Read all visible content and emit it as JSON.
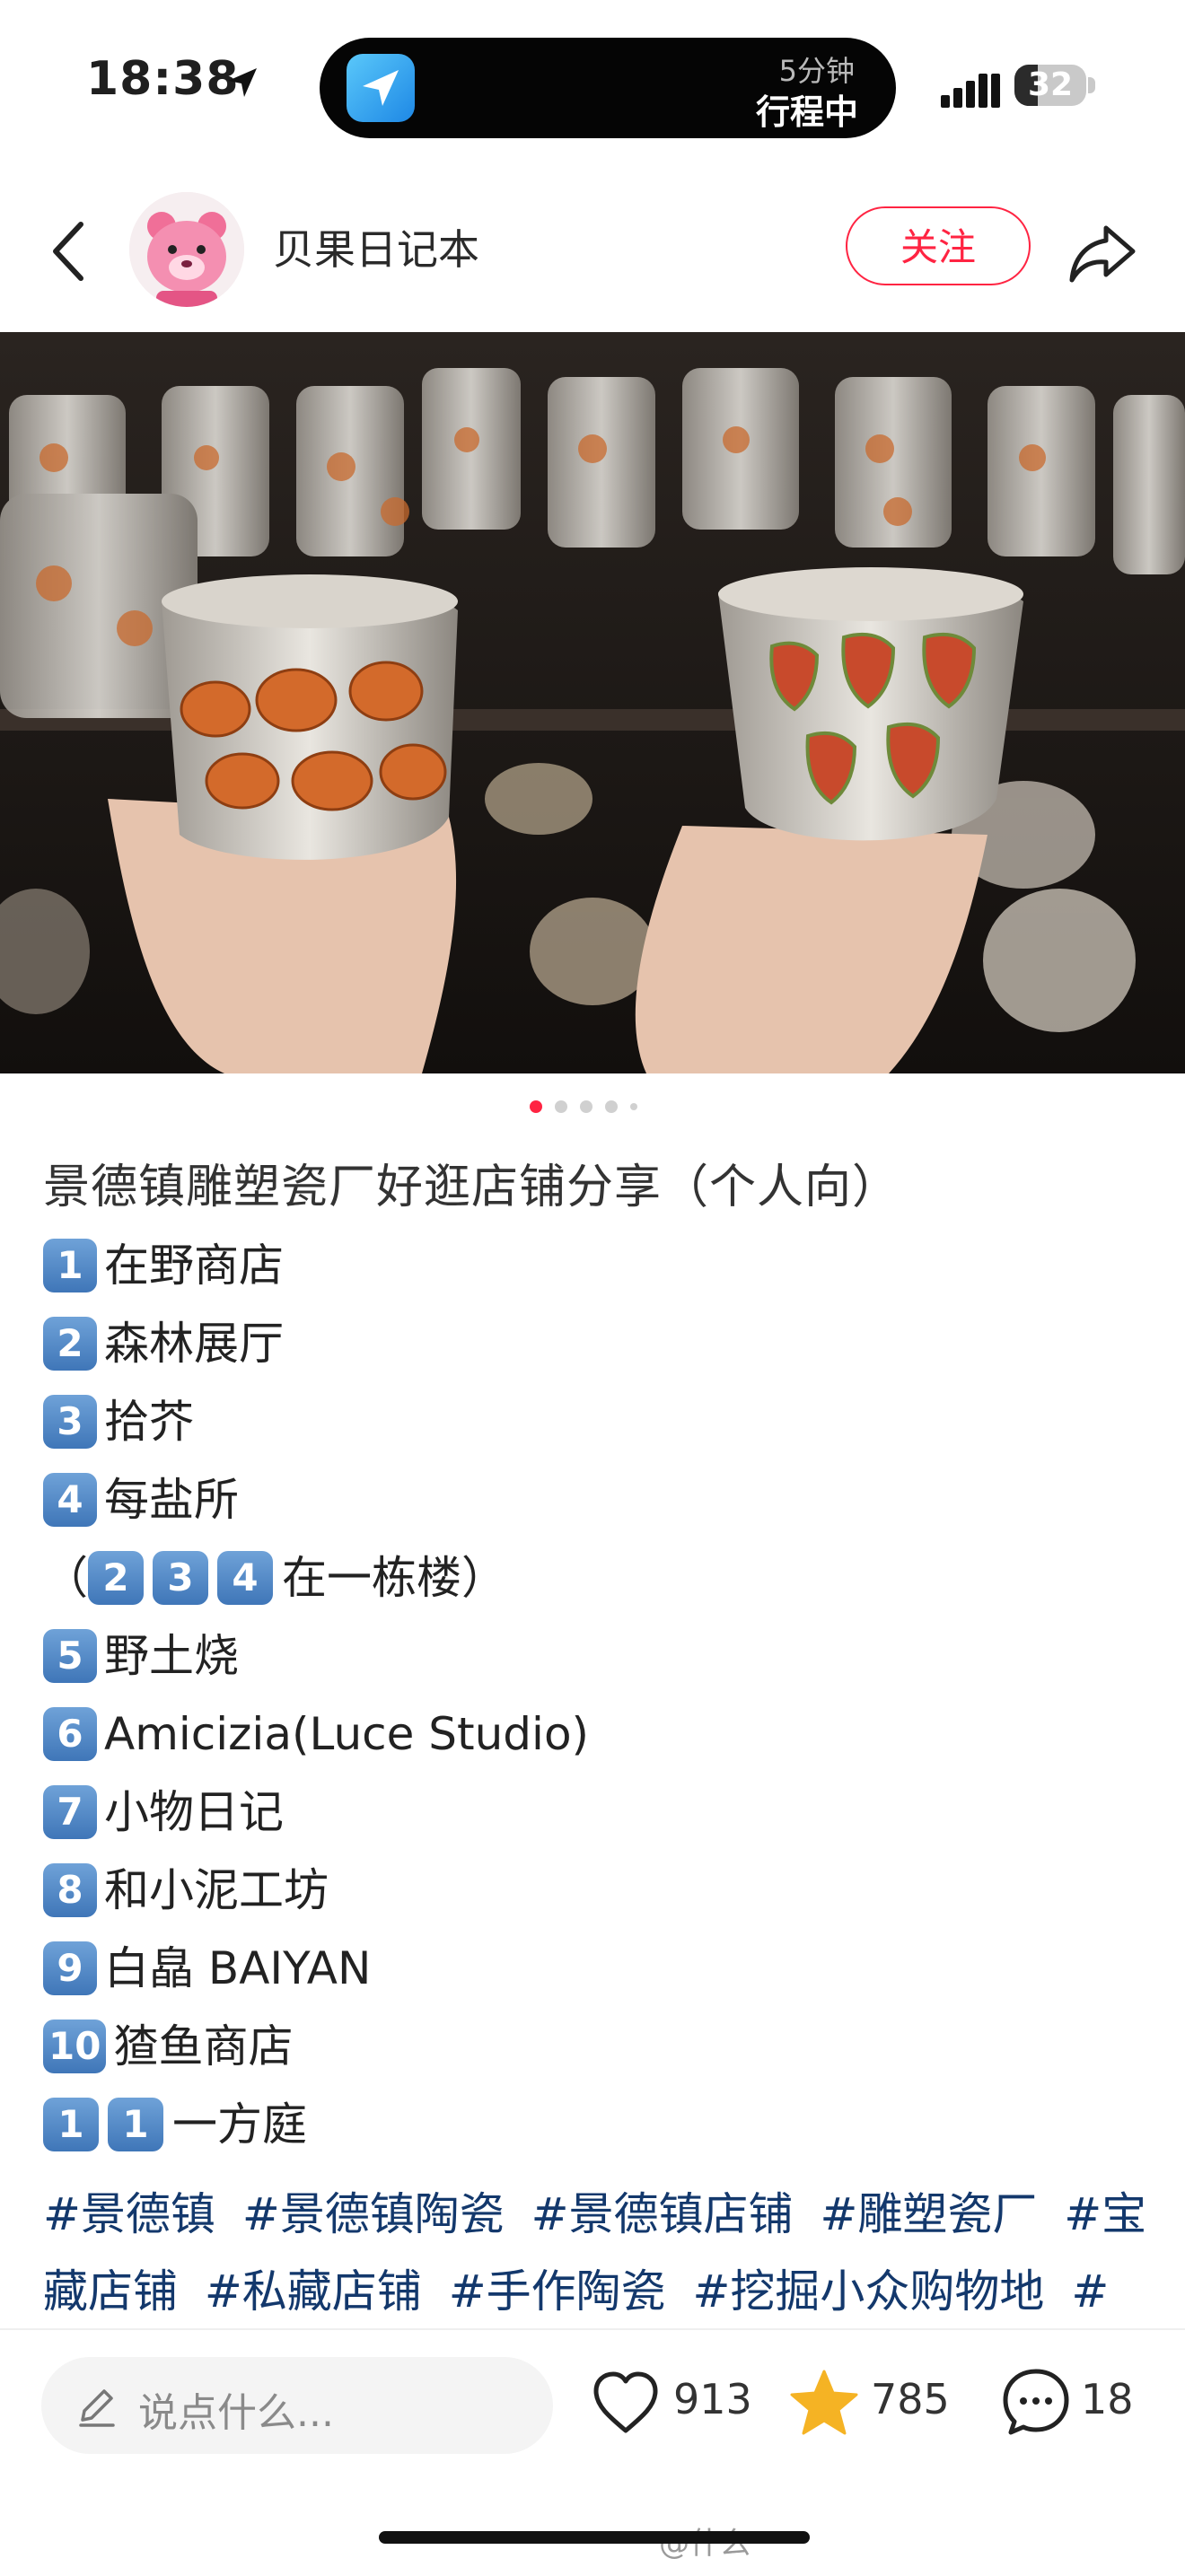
{
  "status_bar": {
    "time": "18:38",
    "island_eta": "5分钟",
    "island_status": "行程中",
    "battery": "32",
    "battery_level": 0.32,
    "icons": [
      "location-arrow-icon",
      "maps-app-icon",
      "signal-icon",
      "battery-icon"
    ]
  },
  "header": {
    "author": "贝果日记本",
    "follow_label": "关注",
    "icons": [
      "back-icon",
      "avatar",
      "share-icon"
    ]
  },
  "photo": {
    "carousel_count": 5,
    "active_index": 0
  },
  "post": {
    "title": "景德镇雕塑瓷厂好逛店铺分享（个人向）",
    "items": [
      {
        "keys": [
          "1"
        ],
        "text": "在野商店"
      },
      {
        "keys": [
          "2"
        ],
        "text": "森林展厅"
      },
      {
        "keys": [
          "3"
        ],
        "text": "拾芥"
      },
      {
        "keys": [
          "4"
        ],
        "text": "每盐所"
      },
      {
        "prefix": "（",
        "keys": [
          "2",
          "3",
          "4"
        ],
        "text": "在一栋楼）"
      },
      {
        "keys": [
          "5"
        ],
        "text": "野土烧"
      },
      {
        "keys": [
          "6"
        ],
        "text": "Amicizia(Luce Studio)"
      },
      {
        "keys": [
          "7"
        ],
        "text": "小物日记"
      },
      {
        "keys": [
          "8"
        ],
        "text": "和小泥工坊"
      },
      {
        "keys": [
          "9"
        ],
        "text": "白皛 BAIYAN"
      },
      {
        "keys": [
          "10"
        ],
        "text": "猹鱼商店"
      },
      {
        "keys": [
          "1",
          "1"
        ],
        "text": "一方庭"
      }
    ],
    "tags": [
      "#景德镇",
      "#景德镇陶瓷",
      "#景德镇店铺",
      "#雕塑瓷厂",
      "#宝藏店铺",
      "#私藏店铺",
      "#手作陶瓷",
      "#挖掘小众购物地",
      "#景"
    ]
  },
  "bottom_bar": {
    "comment_placeholder": "说点什么...",
    "likes": "913",
    "favorites": "785",
    "comments": "18",
    "colors": {
      "accent": "#ff2442",
      "star": "#f5b324",
      "tag": "#13386c"
    }
  },
  "watermark": "@什么"
}
